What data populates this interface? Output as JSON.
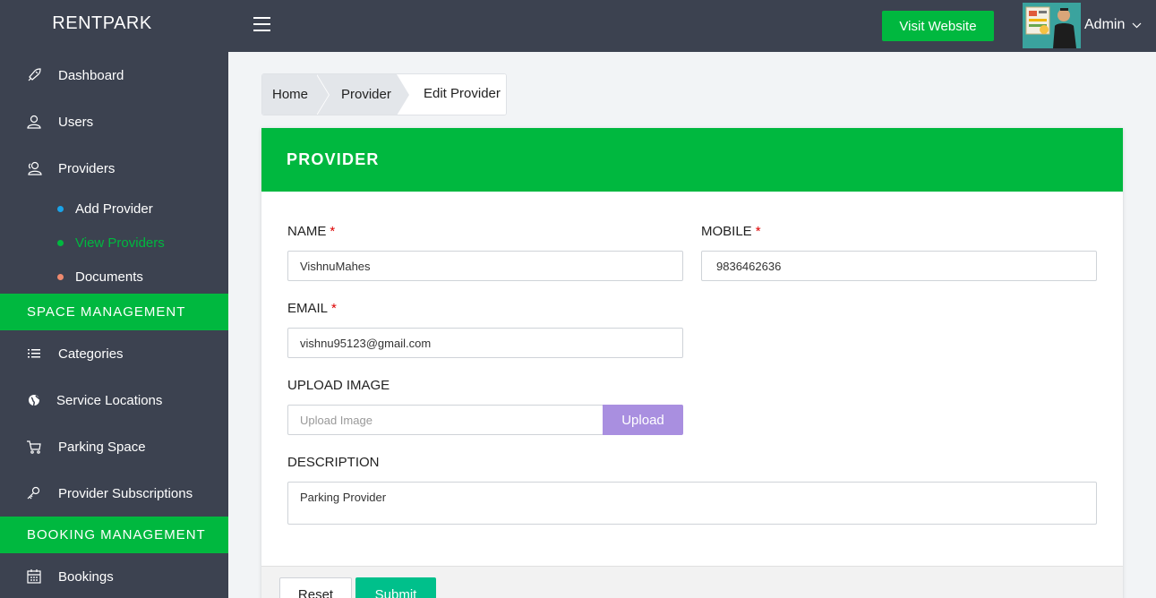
{
  "app": {
    "brand": "RENTPARK"
  },
  "header": {
    "visit_label": "Visit Website",
    "user_label": "Admin"
  },
  "sidebar": {
    "items": [
      {
        "label": "Dashboard",
        "icon": "rocket-icon"
      },
      {
        "label": "Users",
        "icon": "user-icon"
      },
      {
        "label": "Providers",
        "icon": "users-icon"
      }
    ],
    "sub_items": [
      {
        "label": "Add Provider",
        "color": "#1aa3e8"
      },
      {
        "label": "View Providers",
        "color": "#00b83f"
      },
      {
        "label": "Documents",
        "color": "#ef8a6f"
      }
    ],
    "section_space": "SPACE MANAGEMENT",
    "space_items": [
      {
        "label": "Categories",
        "icon": "list-icon"
      },
      {
        "label": "Service Locations",
        "icon": "globe-icon"
      },
      {
        "label": "Parking Space",
        "icon": "cart-icon"
      },
      {
        "label": "Provider Subscriptions",
        "icon": "key-icon"
      }
    ],
    "section_booking": "BOOKING MANAGEMENT",
    "booking_items": [
      {
        "label": "Bookings",
        "icon": "calendar-icon"
      }
    ]
  },
  "breadcrumb": {
    "home": "Home",
    "provider": "Provider",
    "current": "Edit Provider"
  },
  "form": {
    "title": "PROVIDER",
    "name_label": "NAME",
    "name_value": "VishnuMahes",
    "mobile_label": "MOBILE",
    "mobile_value": "9836462636",
    "email_label": "EMAIL",
    "email_value": "vishnu95123@gmail.com",
    "upload_label": "UPLOAD IMAGE",
    "upload_placeholder": "Upload Image",
    "upload_button": "Upload",
    "description_label": "DESCRIPTION",
    "description_value": "Parking Provider",
    "required_mark": "*",
    "reset_label": "Reset",
    "submit_label": "Submit"
  }
}
